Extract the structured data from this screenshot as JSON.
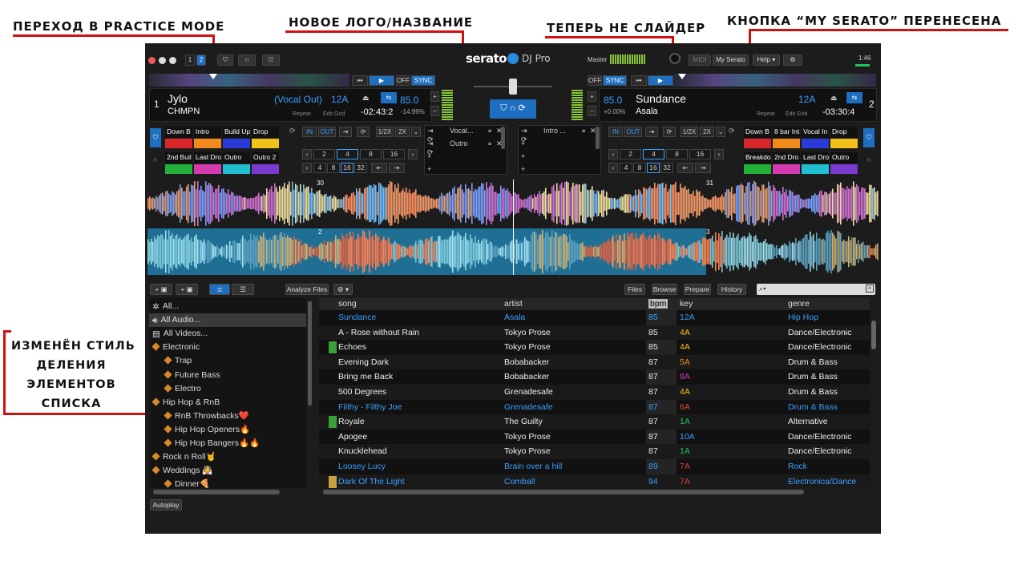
{
  "annotations": {
    "practice_mode": "Переход в Practice mode",
    "new_logo": "Новое лого/название",
    "not_slider": "Теперь не слайдер",
    "my_serato_moved": "Кнопка “My Serato” перенесена",
    "list_style": [
      "Изменён стиль",
      "деления",
      "элементов",
      "списка"
    ]
  },
  "app": {
    "logo": "serato",
    "logo_sub": "DJ Pro",
    "master_label": "Master",
    "midi_label": "MIDI",
    "my_serato_label": "My Serato",
    "help_label": "Help ▾",
    "clock": "1:46",
    "deck_buttons": [
      "1",
      "2"
    ]
  },
  "deck_left": {
    "number": "1",
    "title": "Jylo",
    "artist": "CHMPN",
    "cue_label": "(Vocal Out)",
    "key": "12A",
    "time": "-02:43:2",
    "bpm": "85.0",
    "pitch": "-14.99%",
    "repeat": "Repeat",
    "edit_grid": "Edit Grid",
    "off": "OFF",
    "sync": "SYNC",
    "cues": [
      {
        "label": "Down B",
        "color": "#d8262b"
      },
      {
        "label": "Intro",
        "color": "#f08a1c"
      },
      {
        "label": "Build Up",
        "color": "#2a3ad8"
      },
      {
        "label": "Drop",
        "color": "#f2c21a"
      },
      {
        "label": "2nd Buil",
        "color": "#22b03a"
      },
      {
        "label": "Last Dro",
        "color": "#d43bb0"
      },
      {
        "label": "Outro",
        "color": "#1fbfcf"
      },
      {
        "label": "Outro 2",
        "color": "#7a3ad0"
      }
    ]
  },
  "deck_right": {
    "number": "2",
    "title": "Sundance",
    "artist": "Asala",
    "key": "12A",
    "time": "-03:30:4",
    "bpm": "85.0",
    "pitch": "+0.00%",
    "repeat": "Repeat",
    "edit_grid": "Edit Grid",
    "off": "OFF",
    "sync": "SYNC",
    "cues": [
      {
        "label": "Down B",
        "color": "#d8262b"
      },
      {
        "label": "8 bar Int",
        "color": "#f08a1c"
      },
      {
        "label": "Vocal In",
        "color": "#2a3ad8"
      },
      {
        "label": "Drop",
        "color": "#f2c21a"
      },
      {
        "label": "Breakdo",
        "color": "#22b03a"
      },
      {
        "label": "2nd Dro",
        "color": "#d43bb0"
      },
      {
        "label": "Last Dro",
        "color": "#1fbfcf"
      },
      {
        "label": "Outro",
        "color": "#7a3ad0"
      }
    ]
  },
  "loop_left": {
    "in": "IN",
    "out": "OUT",
    "half": "1/2X",
    "double": "2X",
    "row1": [
      "2",
      "4",
      "8",
      "16"
    ],
    "row2": [
      "4",
      "8",
      "16",
      "32"
    ]
  },
  "loop_right": {
    "in": "IN",
    "out": "OUT",
    "half": "1/2X",
    "double": "2X",
    "row1": [
      "2",
      "4",
      "8",
      "16"
    ],
    "row2": [
      "4",
      "8",
      "16",
      "32"
    ]
  },
  "saved_loops_left": [
    "Vocal...",
    "Outro"
  ],
  "saved_loops_right": [
    "Intro ..."
  ],
  "wave_markers": {
    "top_a": "30",
    "top_b": "31",
    "bottom_a": "2",
    "bottom_b": "3"
  },
  "library": {
    "analyze": "Analyze Files",
    "gear": "⚙ ▾",
    "files": "Files",
    "browse": "Browse",
    "prepare": "Prepare",
    "history": "History",
    "autoplay": "Autoplay",
    "crates": [
      {
        "label": "All...",
        "indent": 0
      },
      {
        "label": "All Audio...",
        "indent": 0,
        "selected": true
      },
      {
        "label": "All Videos...",
        "indent": 0
      },
      {
        "label": "Electronic",
        "indent": 0
      },
      {
        "label": "Trap",
        "indent": 1
      },
      {
        "label": "Future Bass",
        "indent": 1
      },
      {
        "label": "Electro",
        "indent": 1
      },
      {
        "label": "Hip Hop & RnB",
        "indent": 0
      },
      {
        "label": "RnB Throwbacks❤️",
        "indent": 1
      },
      {
        "label": "Hip Hop Openers🔥",
        "indent": 1
      },
      {
        "label": "Hip Hop Bangers🔥🔥",
        "indent": 1
      },
      {
        "label": "Rock n Roll🤘",
        "indent": 0
      },
      {
        "label": "Weddings 👰",
        "indent": 0
      },
      {
        "label": "Dinner🍕",
        "indent": 1
      }
    ],
    "columns": [
      "song",
      "artist",
      "bpm",
      "key",
      "genre"
    ],
    "rows": [
      {
        "song": "Sundance",
        "artist": "Asala",
        "bpm": "85",
        "key": "12A",
        "key_color": "#3aa0ff",
        "genre": "Hip Hop",
        "blue": true
      },
      {
        "song": "A - Rose without Rain",
        "artist": "Tokyo Prose",
        "bpm": "85",
        "key": "4A",
        "key_color": "#f2c21a",
        "genre": "Dance/Electronic"
      },
      {
        "song": "Echoes",
        "artist": "Tokyo Prose",
        "bpm": "85",
        "key": "4A",
        "key_color": "#f2c21a",
        "genre": "Dance/Electronic"
      },
      {
        "song": "Evening Dark",
        "artist": "Bobabacker",
        "bpm": "87",
        "key": "5A",
        "key_color": "#f08a1c",
        "genre": "Drum & Bass"
      },
      {
        "song": "Bring me Back",
        "artist": "Bobabacker",
        "bpm": "87",
        "key": "8A",
        "key_color": "#d43bb0",
        "genre": "Drum & Bass"
      },
      {
        "song": "500 Degrees",
        "artist": "Grenadesafe",
        "bpm": "87",
        "key": "4A",
        "key_color": "#f2c21a",
        "genre": "Drum & Bass"
      },
      {
        "song": "Filthy - Filthy Joe",
        "artist": "Grenadesafe",
        "bpm": "87",
        "key": "6A",
        "key_color": "#e04a2a",
        "genre": "Drum & Bass",
        "blue": true
      },
      {
        "song": "Royale",
        "artist": "The Guilty",
        "bpm": "87",
        "key": "1A",
        "key_color": "#22c05a",
        "genre": "Alternative"
      },
      {
        "song": "Apogee",
        "artist": "Tokyo Prose",
        "bpm": "87",
        "key": "10A",
        "key_color": "#3aa0ff",
        "genre": "Dance/Electronic"
      },
      {
        "song": "Knucklehead",
        "artist": "Tokyo Prose",
        "bpm": "87",
        "key": "1A",
        "key_color": "#22c05a",
        "genre": "Dance/Electronic"
      },
      {
        "song": "Loosey Lucy",
        "artist": "Brain over a hill",
        "bpm": "89",
        "key": "7A",
        "key_color": "#e03a3a",
        "genre": "Rock",
        "blue": true
      },
      {
        "song": "Dark Of The Light",
        "artist": "Comball",
        "bpm": "94",
        "key": "7A",
        "key_color": "#e03a3a",
        "genre": "Electronica/Dance",
        "blue": true
      }
    ]
  }
}
